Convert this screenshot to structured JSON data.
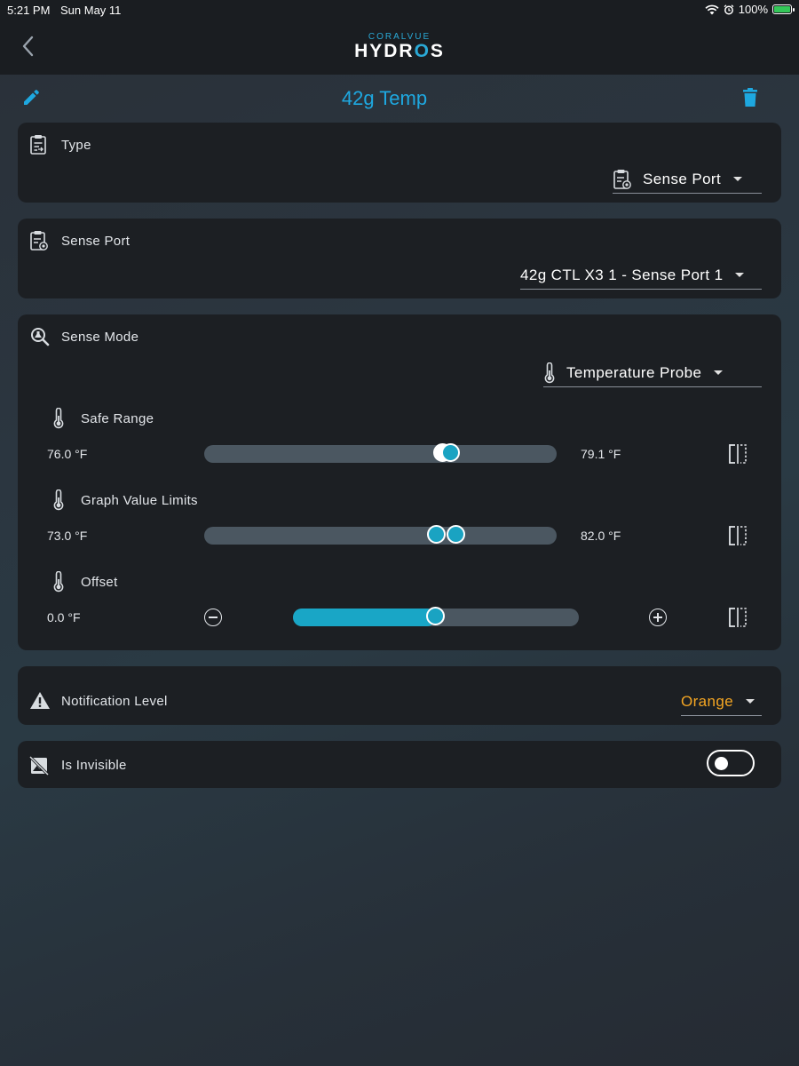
{
  "status_bar": {
    "time": "5:21 PM",
    "date": "Sun May 11",
    "battery": "100%"
  },
  "nav": {
    "logo_small": "CORALVUE",
    "logo_big_1": "HYDR",
    "logo_big_2": "O",
    "logo_big_3": "S"
  },
  "page": {
    "title": "42g Temp"
  },
  "type_card": {
    "label": "Type",
    "value": "Sense Port"
  },
  "sense_port_card": {
    "label": "Sense Port",
    "value": "42g CTL X3 1 - Sense Port 1"
  },
  "sense_mode_card": {
    "label": "Sense Mode",
    "value": "Temperature Probe",
    "safe_range": {
      "label": "Safe Range",
      "min": "76.0 °F",
      "max": "79.1 °F"
    },
    "graph_limits": {
      "label": "Graph Value Limits",
      "min": "73.0 °F",
      "max": "82.0 °F"
    },
    "offset": {
      "label": "Offset",
      "value": "0.0 °F",
      "level": 0.5
    }
  },
  "notification_card": {
    "label": "Notification Level",
    "value": "Orange",
    "value_color": "#f5a623"
  },
  "invisible_card": {
    "label": "Is Invisible",
    "enabled": false
  },
  "colors": {
    "accent": "#1ea8e0",
    "slider": "#1aa3c2"
  }
}
